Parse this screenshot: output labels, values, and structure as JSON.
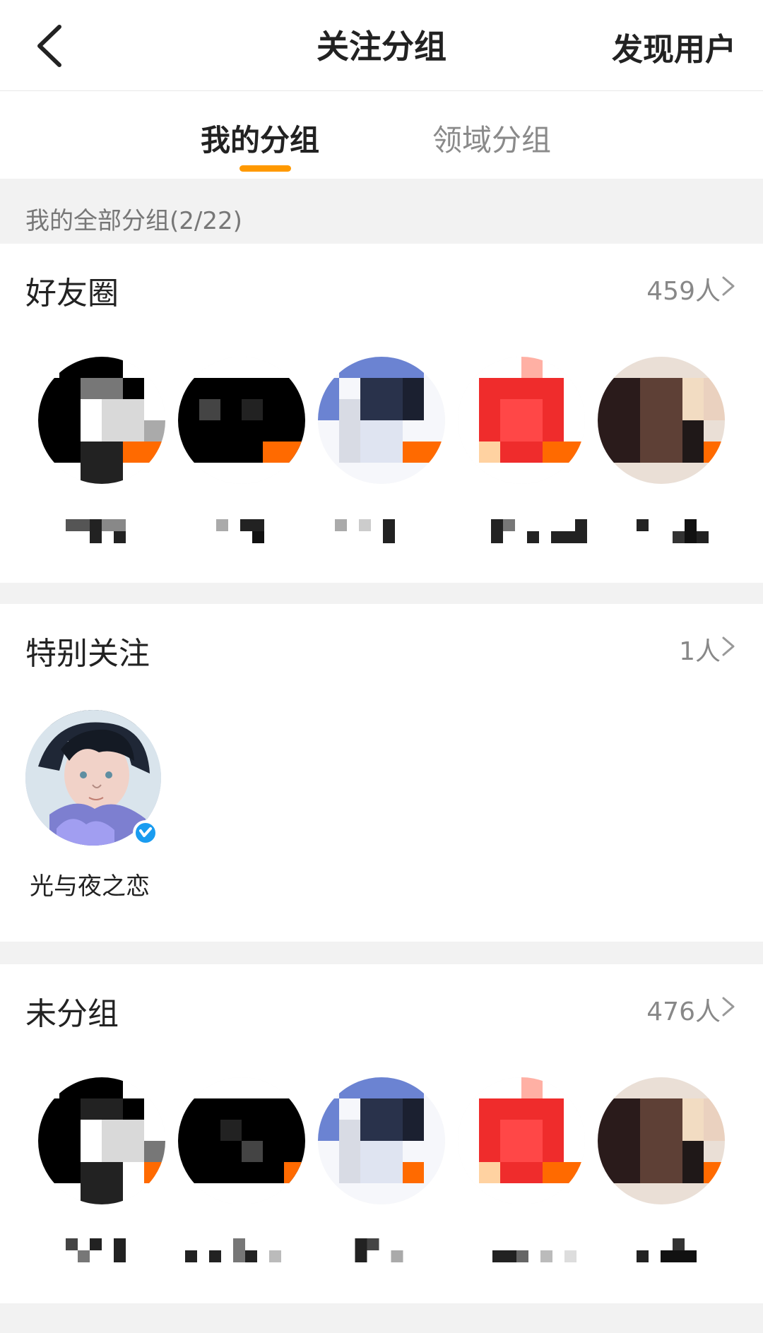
{
  "header": {
    "title": "关注分组",
    "right_action": "发现用户",
    "back_icon": "chevron-left-icon"
  },
  "tabs": [
    {
      "label": "我的分组",
      "active": true
    },
    {
      "label": "领域分组",
      "active": false
    }
  ],
  "section_caption": "我的全部分组(2/22)",
  "groups": [
    {
      "name": "好友圈",
      "count": "459人"
    },
    {
      "name": "特别关注",
      "count": "1人",
      "members": [
        {
          "name": "光与夜之恋"
        }
      ]
    },
    {
      "name": "未分组",
      "count": "476人"
    }
  ],
  "colors": {
    "accent": "#ff9900",
    "verified": "#1a9cf0"
  }
}
